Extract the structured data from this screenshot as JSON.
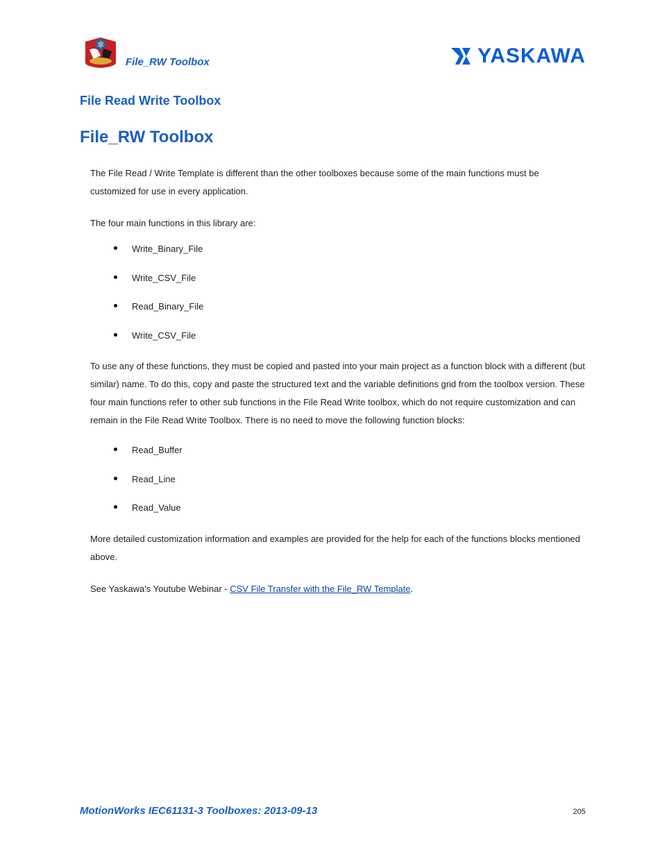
{
  "header": {
    "toolbox_title": "File_RW Toolbox",
    "company": "YASKAWA"
  },
  "section_title": "File Read Write Toolbox",
  "main_title": "File_RW Toolbox",
  "para1": "The File Read / Write Template is different than the other toolboxes because some of the main functions must be customized for use in every application.",
  "para2": "The four main functions in this library are:",
  "list1": [
    "Write_Binary_File",
    "Write_CSV_File",
    "Read_Binary_File",
    "Write_CSV_File"
  ],
  "para3": "To use any of these functions, they must be copied and pasted into your main project as a function block with a different (but similar) name.  To do this, copy and paste the structured text and the variable definitions grid from the toolbox version. These four main functions refer to other sub functions in the File Read Write toolbox, which do not require customization and can remain in the File Read Write Toolbox.  There is no need to move the following function blocks:",
  "list2": [
    "Read_Buffer",
    "Read_Line",
    "Read_Value"
  ],
  "para4": "More detailed customization information and examples are provided for the help for each of the functions blocks mentioned above.",
  "para5_prefix": "See Yaskawa's Youtube Webinar - ",
  "para5_link": "CSV File Transfer with the File_RW Template",
  "para5_suffix": ".",
  "footer": {
    "text": "MotionWorks IEC61131-3 Toolboxes: 2013-09-13",
    "page": "205"
  }
}
